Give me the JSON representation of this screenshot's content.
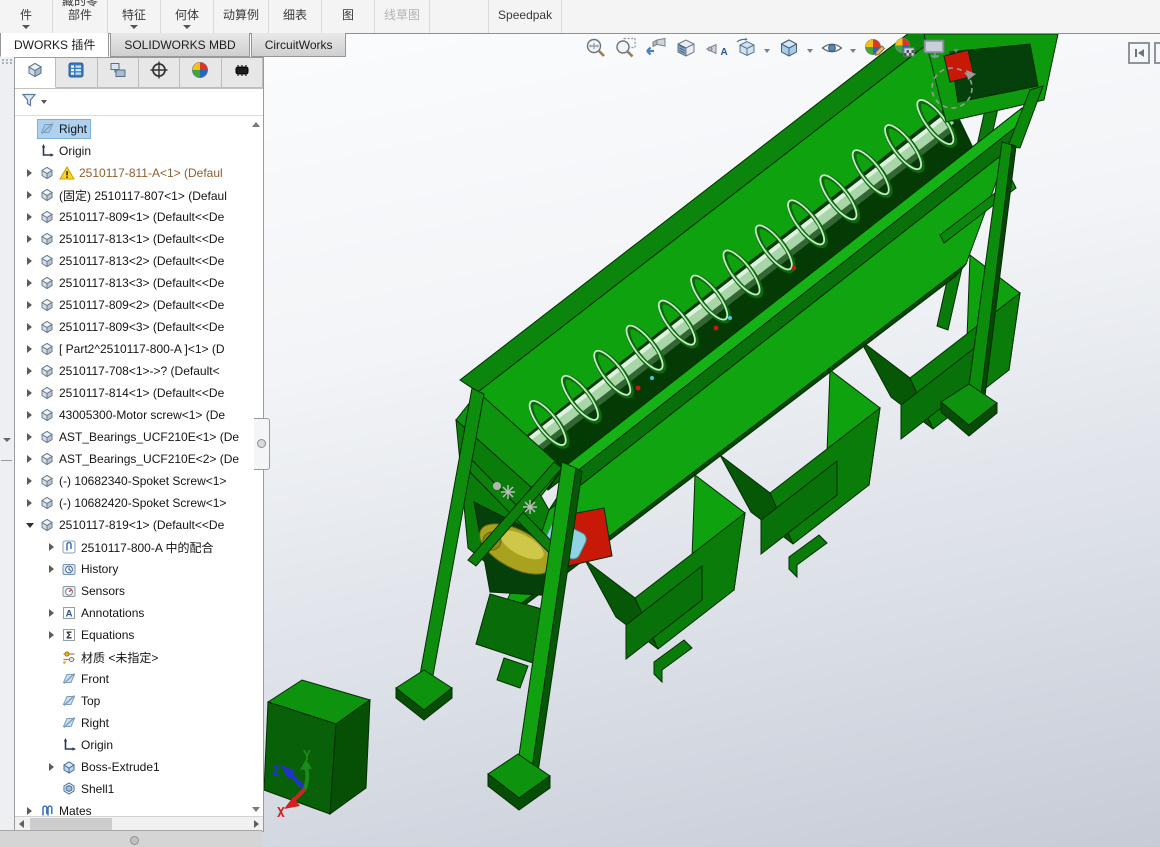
{
  "ribbon": {
    "items": [
      {
        "id": "components",
        "lines": [
          "件"
        ],
        "caret": true
      },
      {
        "id": "hidden-components",
        "lines": [
          "藏的零",
          "部件"
        ],
        "caret": false
      },
      {
        "id": "assembly-features",
        "lines": [
          "特征"
        ],
        "caret": true
      },
      {
        "id": "reference-geometry",
        "lines": [
          "何体"
        ],
        "caret": true
      },
      {
        "id": "motion-study",
        "lines": [
          "动算例"
        ],
        "caret": false
      },
      {
        "id": "bill-of-materials",
        "lines": [
          "细表"
        ],
        "caret": false
      },
      {
        "id": "exploded-view",
        "lines": [
          "图"
        ],
        "caret": false
      },
      {
        "id": "explode-line-sketch",
        "lines": [
          "线草图"
        ],
        "caret": false,
        "disabled": true
      },
      {
        "id": "speedpak",
        "lines": [
          "Speedpak"
        ],
        "caret": false
      }
    ]
  },
  "tabs": {
    "items": [
      {
        "label": "DWORKS 插件",
        "active": true
      },
      {
        "label": "SOLIDWORKS MBD",
        "active": false
      },
      {
        "label": "CircuitWorks",
        "active": false
      }
    ]
  },
  "panel": {
    "tab_icons": [
      "featuremanager-tree",
      "propertymanager",
      "configurationmanager",
      "dimxpertmanager",
      "displaymanager",
      "addins"
    ],
    "active_tab": 0,
    "filter_icon": "filter-funnel"
  },
  "tree": {
    "items": [
      {
        "icon": "plane",
        "label": "Right",
        "selected": true,
        "indent": 0,
        "expand": "none"
      },
      {
        "icon": "origin",
        "label": "Origin",
        "indent": 0,
        "expand": "none"
      },
      {
        "icon": "component",
        "label": "2510117-811-A<1>  (Defaul",
        "indent": 0,
        "expand": "r",
        "warning": true
      },
      {
        "icon": "component",
        "label": "(固定) 2510117-807<1>  (Defaul",
        "indent": 0,
        "expand": "r"
      },
      {
        "icon": "component",
        "label": "2510117-809<1>  (Default<<De",
        "indent": 0,
        "expand": "r"
      },
      {
        "icon": "component",
        "label": "2510117-813<1>  (Default<<De",
        "indent": 0,
        "expand": "r"
      },
      {
        "icon": "component",
        "label": "2510117-813<2>  (Default<<De",
        "indent": 0,
        "expand": "r"
      },
      {
        "icon": "component",
        "label": "2510117-813<3>  (Default<<De",
        "indent": 0,
        "expand": "r"
      },
      {
        "icon": "component",
        "label": "2510117-809<2>  (Default<<De",
        "indent": 0,
        "expand": "r"
      },
      {
        "icon": "component",
        "label": "2510117-809<3>  (Default<<De",
        "indent": 0,
        "expand": "r"
      },
      {
        "icon": "component",
        "label": "[ Part2^2510117-800-A ]<1>  (D",
        "indent": 0,
        "expand": "r"
      },
      {
        "icon": "component",
        "label": "2510117-708<1>->?  (Default<",
        "indent": 0,
        "expand": "r"
      },
      {
        "icon": "component",
        "label": "2510117-814<1>  (Default<<De",
        "indent": 0,
        "expand": "r"
      },
      {
        "icon": "component",
        "label": "43005300-Motor screw<1>  (De",
        "indent": 0,
        "expand": "r"
      },
      {
        "icon": "component",
        "label": "AST_Bearings_UCF210E<1>  (De",
        "indent": 0,
        "expand": "r"
      },
      {
        "icon": "component",
        "label": "AST_Bearings_UCF210E<2>  (De",
        "indent": 0,
        "expand": "r"
      },
      {
        "icon": "component",
        "label": "(-) 10682340-Spoket Screw<1>",
        "indent": 0,
        "expand": "r"
      },
      {
        "icon": "component",
        "label": "(-) 10682420-Spoket Screw<1>",
        "indent": 0,
        "expand": "r"
      },
      {
        "icon": "component",
        "label": "2510117-819<1>  (Default<<De",
        "indent": 0,
        "expand": "d"
      },
      {
        "icon": "mategroup",
        "label": "2510117-800-A 中的配合",
        "indent": 1,
        "expand": "r"
      },
      {
        "icon": "history",
        "label": "History",
        "indent": 1,
        "expand": "r"
      },
      {
        "icon": "sensors",
        "label": "Sensors",
        "indent": 1,
        "expand": "none"
      },
      {
        "icon": "annotations",
        "label": "Annotations",
        "indent": 1,
        "expand": "r"
      },
      {
        "icon": "equations",
        "label": "Equations",
        "indent": 1,
        "expand": "r"
      },
      {
        "icon": "material",
        "label": "材质 <未指定>",
        "indent": 1,
        "expand": "none"
      },
      {
        "icon": "plane",
        "label": "Front",
        "indent": 1,
        "expand": "none"
      },
      {
        "icon": "plane",
        "label": "Top",
        "indent": 1,
        "expand": "none"
      },
      {
        "icon": "plane",
        "label": "Right",
        "indent": 1,
        "expand": "none"
      },
      {
        "icon": "origin",
        "label": "Origin",
        "indent": 1,
        "expand": "none"
      },
      {
        "icon": "extrude",
        "label": "Boss-Extrude1",
        "indent": 1,
        "expand": "r"
      },
      {
        "icon": "shell",
        "label": "Shell1",
        "indent": 1,
        "expand": "none"
      },
      {
        "icon": "mates",
        "label": "Mates",
        "indent": 0,
        "expand": "r"
      }
    ]
  },
  "headsup": {
    "icons": [
      {
        "name": "zoom-to-fit-icon",
        "caret": false
      },
      {
        "name": "zoom-to-area-icon",
        "caret": false
      },
      {
        "name": "previous-view-icon",
        "caret": false
      },
      {
        "name": "section-view-icon",
        "caret": false
      },
      {
        "name": "annotation-visibility-icon",
        "caret": false
      },
      {
        "name": "view-orientation-icon",
        "caret": true
      },
      {
        "name": "display-style-icon",
        "caret": true
      },
      {
        "name": "hide-show-items-icon",
        "caret": true
      },
      {
        "name": "edit-appearance-icon",
        "caret": false
      },
      {
        "name": "apply-scene-icon",
        "caret": false
      },
      {
        "name": "view-settings-icon",
        "caret": true
      }
    ]
  },
  "triad": {
    "x": {
      "label": "X",
      "color": "#d42222"
    },
    "y": {
      "label": "Y",
      "color": "#1a8a1a"
    },
    "z": {
      "label": "Z",
      "color": "#2233cc"
    }
  },
  "palette": {
    "model_bright": "#10a510",
    "model_mid": "#0b850b",
    "model_dark": "#076b07",
    "model_darker": "#054805",
    "model_cavity": "#05400a",
    "model_edge": "#042e04",
    "screw_shaft": "#a8d6a8",
    "screw_flight_dark": "#0a6b0a",
    "screw_flight_light": "#cde8cd",
    "motor_yellow": "#a8a21f",
    "motor_yellow_light": "#cfc74a",
    "motor_cyan": "#8ed4e2",
    "accent_red": "#c81808",
    "selection_blue": "#aed1ef",
    "warning_text": "#8a6030",
    "viewport_top": "#fcfdfe",
    "viewport_bottom": "#c7cbd6"
  }
}
